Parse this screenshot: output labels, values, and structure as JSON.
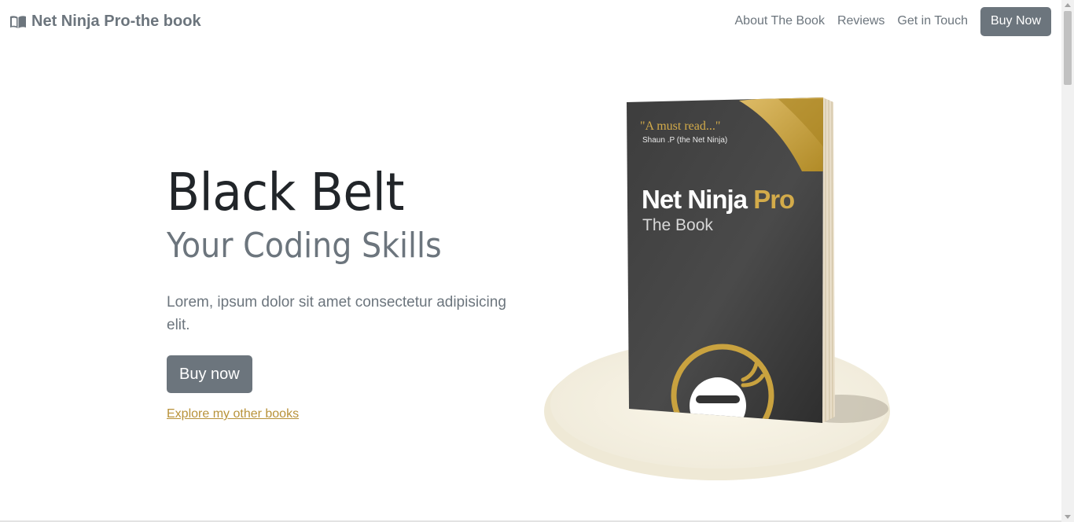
{
  "navbar": {
    "brand": "Net Ninja Pro-the book",
    "brand_icon": "book-icon",
    "links": [
      "About The Book",
      "Reviews",
      "Get in Touch"
    ],
    "buy_label": "Buy Now"
  },
  "hero": {
    "title": "Black Belt",
    "subtitle": "Your Coding Skills",
    "lead": "Lorem, ipsum dolor sit amet consectetur adipisicing elit.",
    "cta_label": "Buy now",
    "explore_label": "Explore my other books"
  },
  "book": {
    "quote": "\"A must read...\"",
    "quote_author": "Shaun .P (the Net Ninja)",
    "title_part1": "Net Ninja",
    "title_part2": "Pro",
    "subtitle": "The Book"
  },
  "colors": {
    "accent": "#6c757d",
    "gold": "#c9a23f",
    "link": "#b8923a",
    "cover": "#3a3a3a"
  }
}
